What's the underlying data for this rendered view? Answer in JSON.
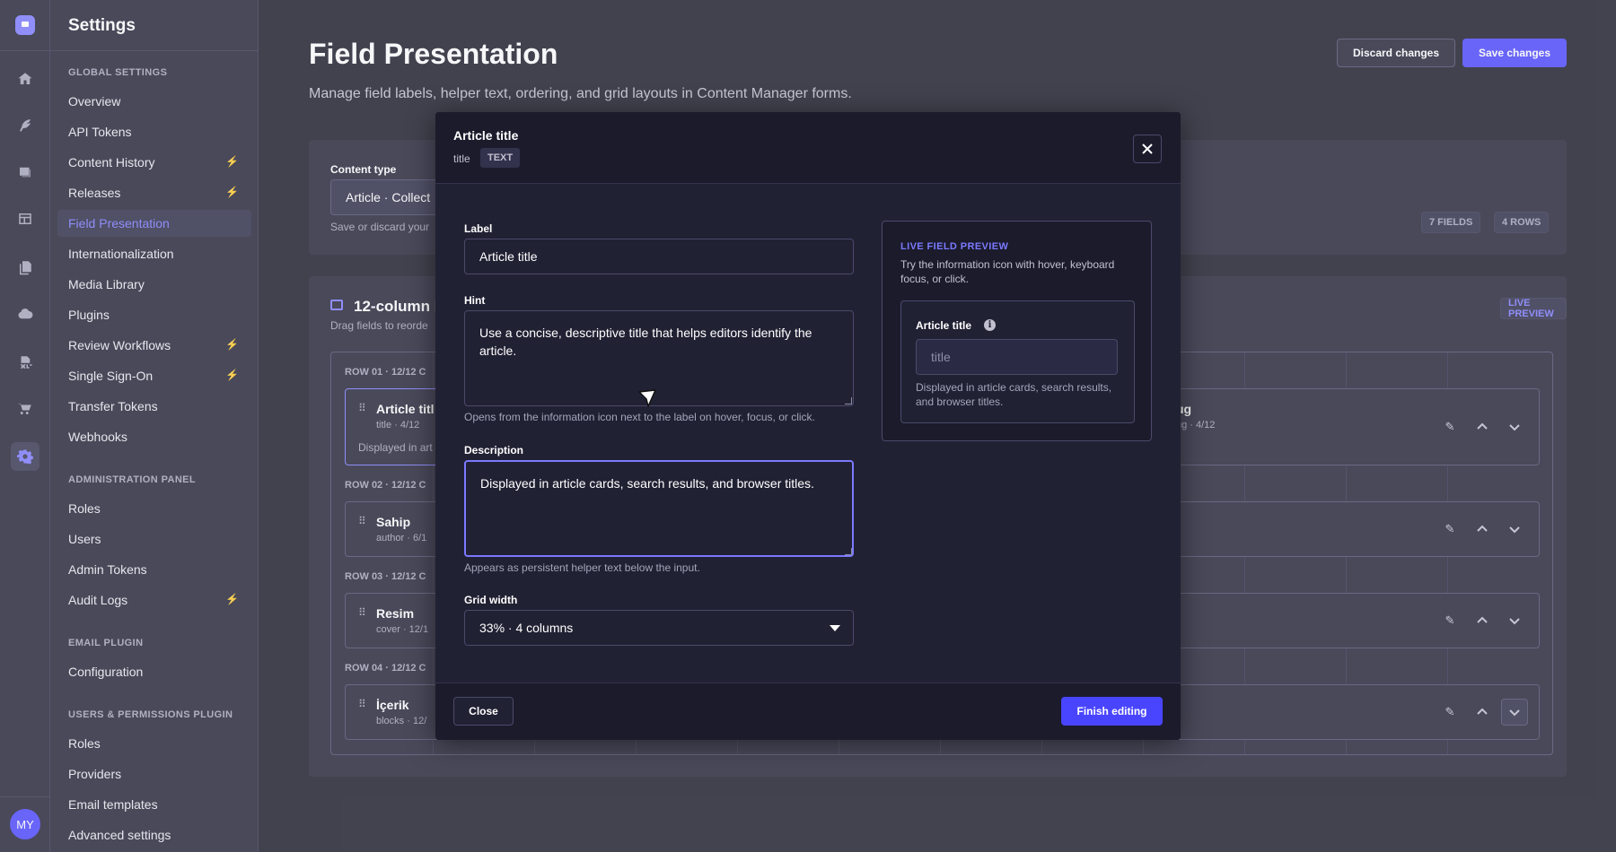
{
  "rail": {
    "icons": [
      "logo-icon",
      "home-icon",
      "feather-icon",
      "image-icon",
      "layout-icon",
      "files-icon",
      "cloud-icon",
      "xls-icon",
      "cart-icon",
      "settings-icon"
    ],
    "avatar": "MY",
    "accent": "#7b79ff"
  },
  "sidebar": {
    "title": "Settings",
    "sections": {
      "global": "GLOBAL SETTINGS",
      "admin": "ADMINISTRATION PANEL",
      "email": "EMAIL PLUGIN",
      "users": "USERS & PERMISSIONS PLUGIN"
    },
    "global_items": [
      {
        "label": "Overview"
      },
      {
        "label": "API Tokens"
      },
      {
        "label": "Content History",
        "bolt": "⚡"
      },
      {
        "label": "Releases",
        "bolt": "⚡"
      },
      {
        "label": "Field Presentation",
        "active": true
      },
      {
        "label": "Internationalization"
      },
      {
        "label": "Media Library"
      },
      {
        "label": "Plugins"
      },
      {
        "label": "Review Workflows",
        "bolt": "⚡"
      },
      {
        "label": "Single Sign-On",
        "bolt": "⚡"
      },
      {
        "label": "Transfer Tokens"
      },
      {
        "label": "Webhooks"
      }
    ],
    "admin_items": [
      {
        "label": "Roles"
      },
      {
        "label": "Users"
      },
      {
        "label": "Admin Tokens"
      },
      {
        "label": "Audit Logs",
        "bolt": "⚡"
      }
    ],
    "email_items": [
      {
        "label": "Configuration"
      }
    ],
    "users_items": [
      {
        "label": "Roles"
      },
      {
        "label": "Providers"
      },
      {
        "label": "Email templates"
      },
      {
        "label": "Advanced settings"
      }
    ]
  },
  "page": {
    "title": "Field Presentation",
    "subtitle": "Manage field labels, helper text, ordering, and grid layouts in Content Manager forms.",
    "discard_label": "Discard changes",
    "save_label": "Save changes"
  },
  "content_type": {
    "label": "Content type",
    "value": "Article · Collect",
    "hint": "Save or discard your",
    "fields_badge": "7 FIELDS",
    "rows_badge": "4 ROWS"
  },
  "grid": {
    "title": "12-column la",
    "subtitle": "Drag fields to reorde",
    "live_badge": "LIVE PREVIEW",
    "rows": [
      {
        "label": "ROW 01 · 12/12 C",
        "left": {
          "name": "Article titl",
          "meta": "title · 4/12",
          "desc": "Displayed in art"
        },
        "right": {
          "name": "ug",
          "meta": "ug · 4/12"
        }
      },
      {
        "label": "ROW 02 · 12/12 C",
        "left": {
          "name": "Sahip",
          "meta": "author · 6/1"
        }
      },
      {
        "label": "ROW 03 · 12/12 C",
        "left": {
          "name": "Resim",
          "meta": "cover · 12/1"
        }
      },
      {
        "label": "ROW 04 · 12/12 C",
        "left": {
          "name": "İçerik",
          "meta": "blocks · 12/"
        }
      }
    ]
  },
  "modal": {
    "title": "Article title",
    "field_name": "title",
    "field_type": "TEXT",
    "label_label": "Label",
    "label_value": "Article title",
    "hint_label": "Hint",
    "hint_value": "Use a concise, descriptive title that helps editors identify the article.",
    "hint_help": "Opens from the information icon next to the label on hover, focus, or click.",
    "description_label": "Description",
    "description_value": "Displayed in article cards, search results, and browser titles.",
    "description_help": "Appears as persistent helper text below the input.",
    "grid_width_label": "Grid width",
    "grid_width_value": "33% · 4 columns",
    "preview": {
      "title": "LIVE FIELD PREVIEW",
      "desc": "Try the information icon with hover, keyboard focus, or click.",
      "field_label": "Article title",
      "info_glyph": "i",
      "placeholder": "title",
      "helper": "Displayed in article cards, search results, and browser titles."
    },
    "close_label": "Close",
    "finish_label": "Finish editing"
  }
}
